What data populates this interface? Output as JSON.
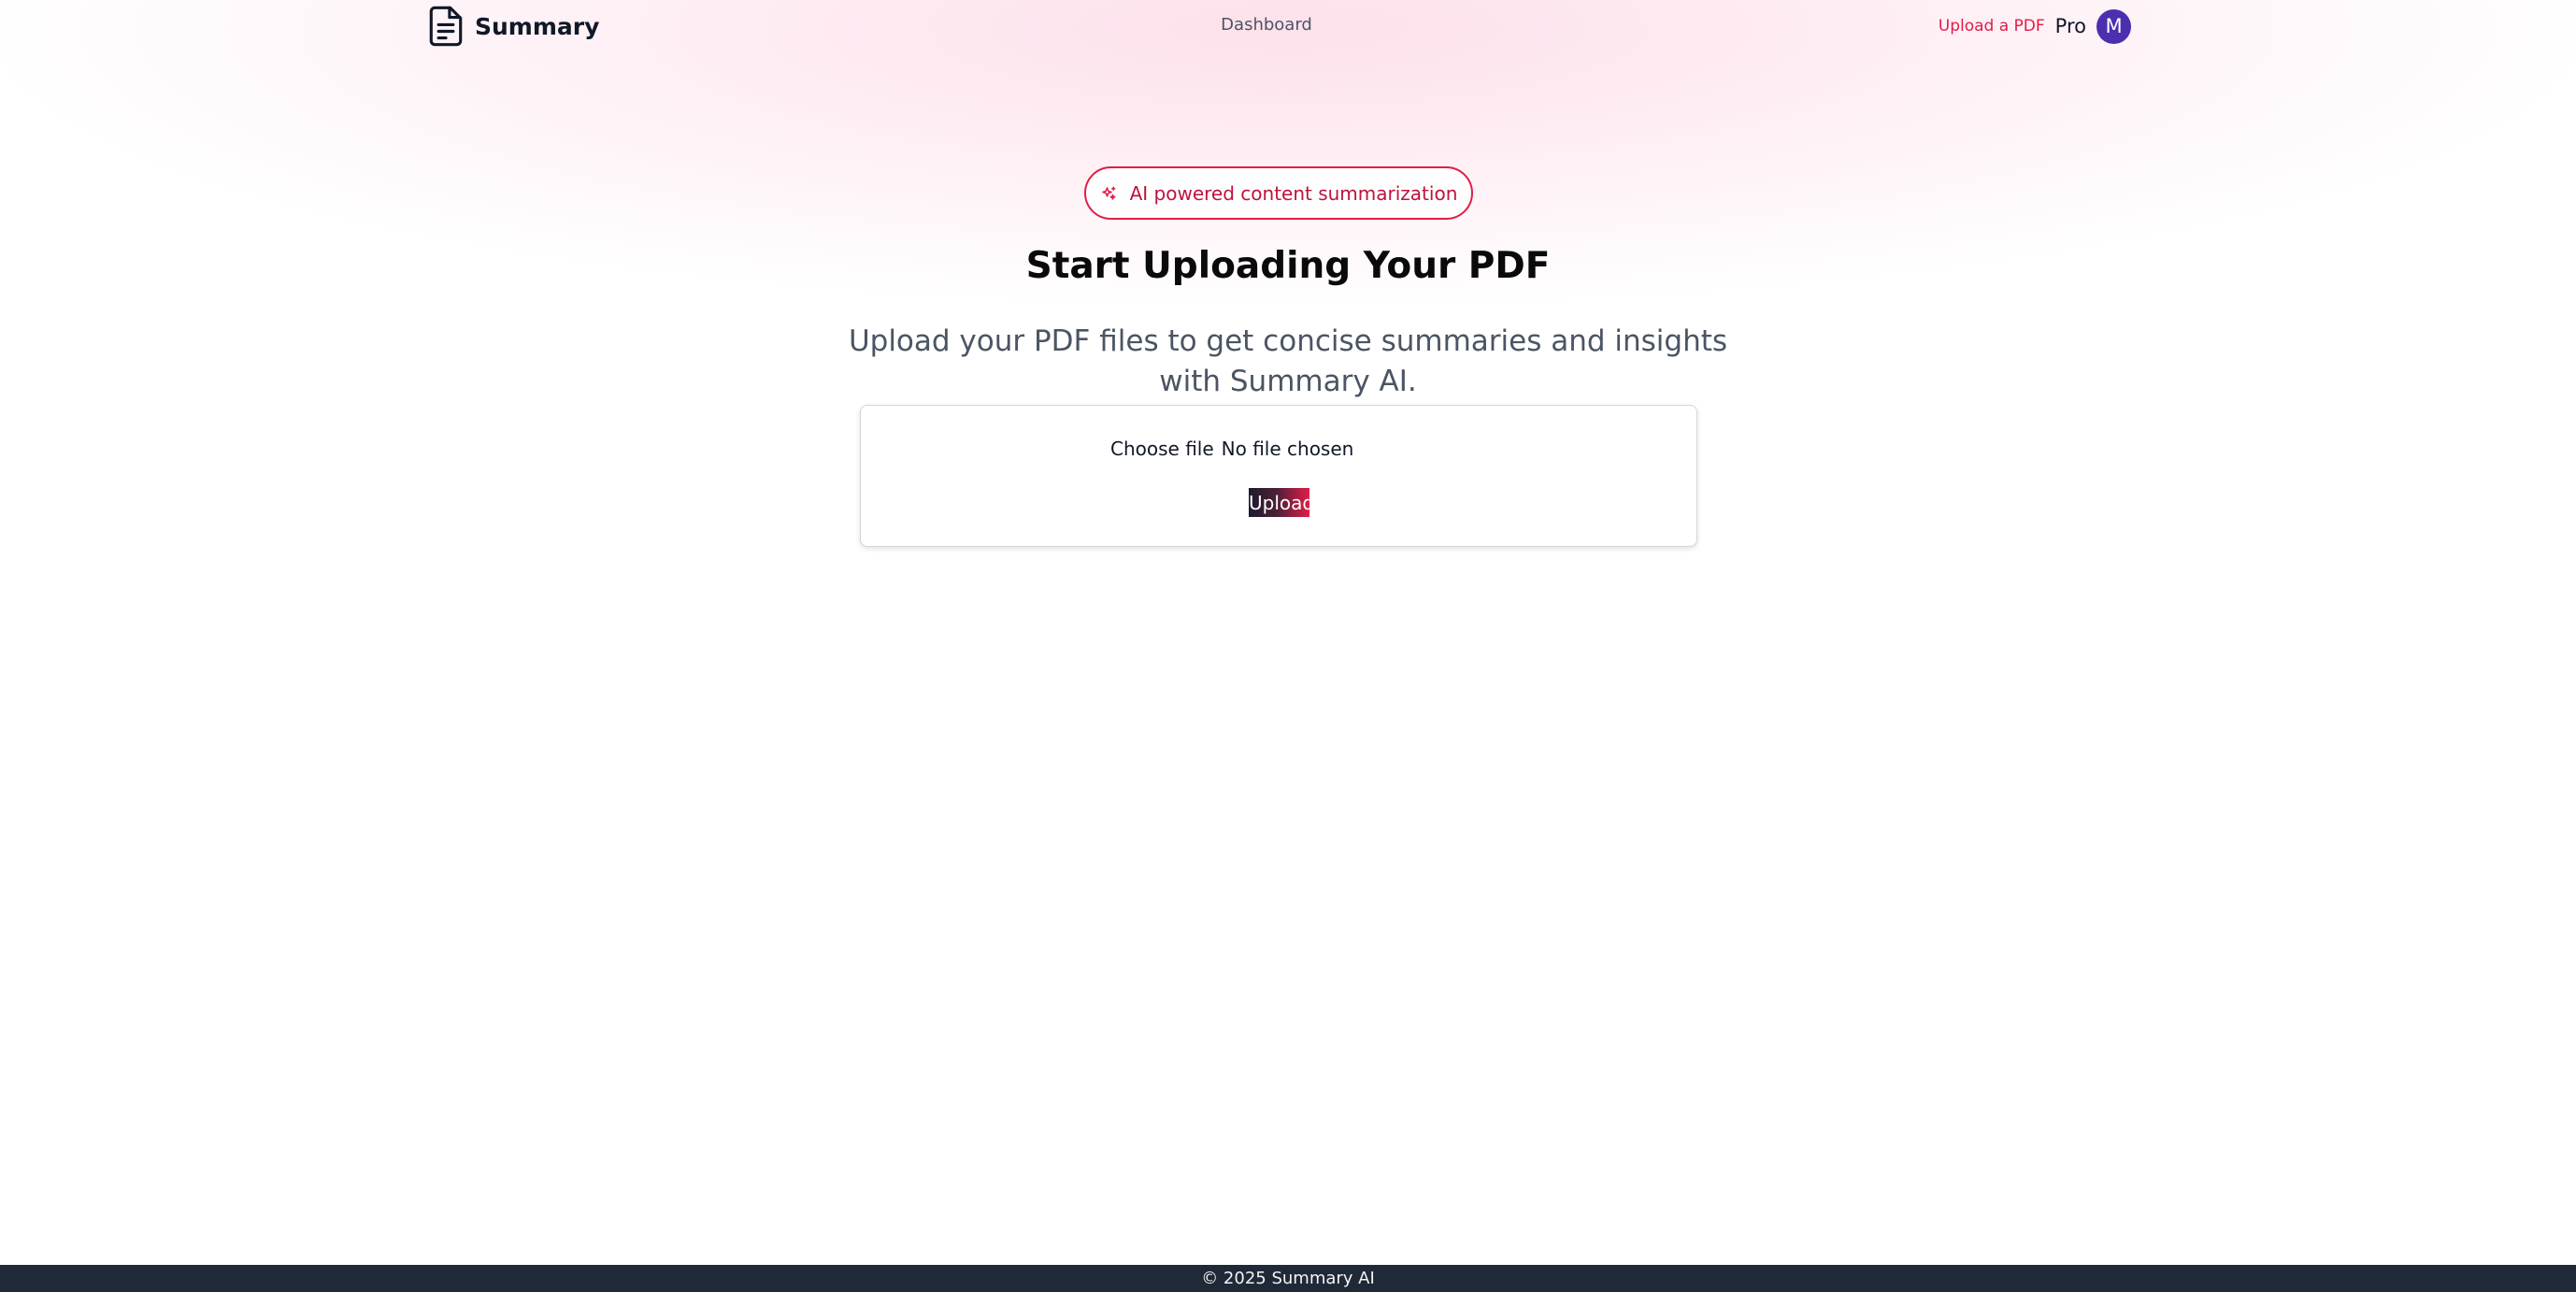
{
  "header": {
    "brand_icon": "document-icon",
    "brand": "Summary",
    "nav_dashboard": "Dashboard",
    "nav_upload": "Upload a PDF",
    "plan": "Pro",
    "avatar_initial": "M"
  },
  "hero": {
    "badge_icon": "sparkles-icon",
    "badge": "AI powered content summarization",
    "title": "Start Uploading Your PDF",
    "subtitle": "Upload your PDF files to get concise summaries and insights with Summary AI."
  },
  "upload": {
    "choose_file_label": "Choose file",
    "file_status": "No file chosen",
    "upload_button": "Upload"
  },
  "footer": {
    "copyright": "© 2025 Summary AI"
  },
  "colors": {
    "accent": "#e11d48",
    "avatar": "#4c2fb0",
    "footer_bg": "#1f2937"
  }
}
